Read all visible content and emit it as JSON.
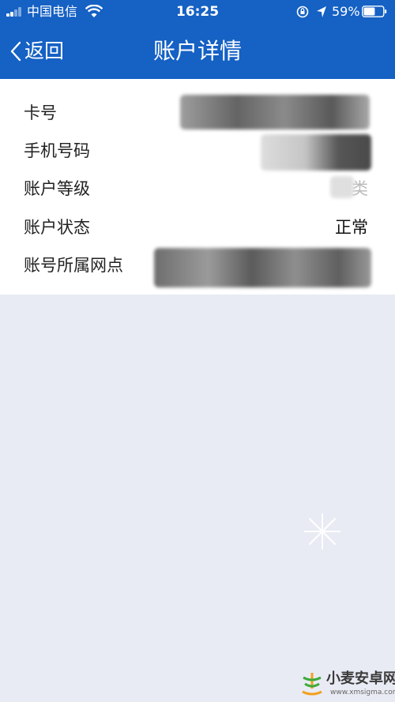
{
  "status_bar": {
    "carrier": "中国电信",
    "time": "16:25",
    "battery_percent": "59%",
    "battery_level": 0.59
  },
  "nav": {
    "back_label": "返回",
    "title": "账户详情"
  },
  "details": [
    {
      "label": "卡号",
      "value": ""
    },
    {
      "label": "手机号码",
      "value": ""
    },
    {
      "label": "账户等级",
      "value": "类"
    },
    {
      "label": "账户状态",
      "value": "正常"
    },
    {
      "label": "账号所属网点",
      "value": ""
    }
  ],
  "watermark": {
    "name": "小麦安卓网",
    "url": "www.xmsigma.com"
  },
  "colors": {
    "header": "#1561c4",
    "background": "#e9ebf4",
    "card": "#ffffff"
  }
}
